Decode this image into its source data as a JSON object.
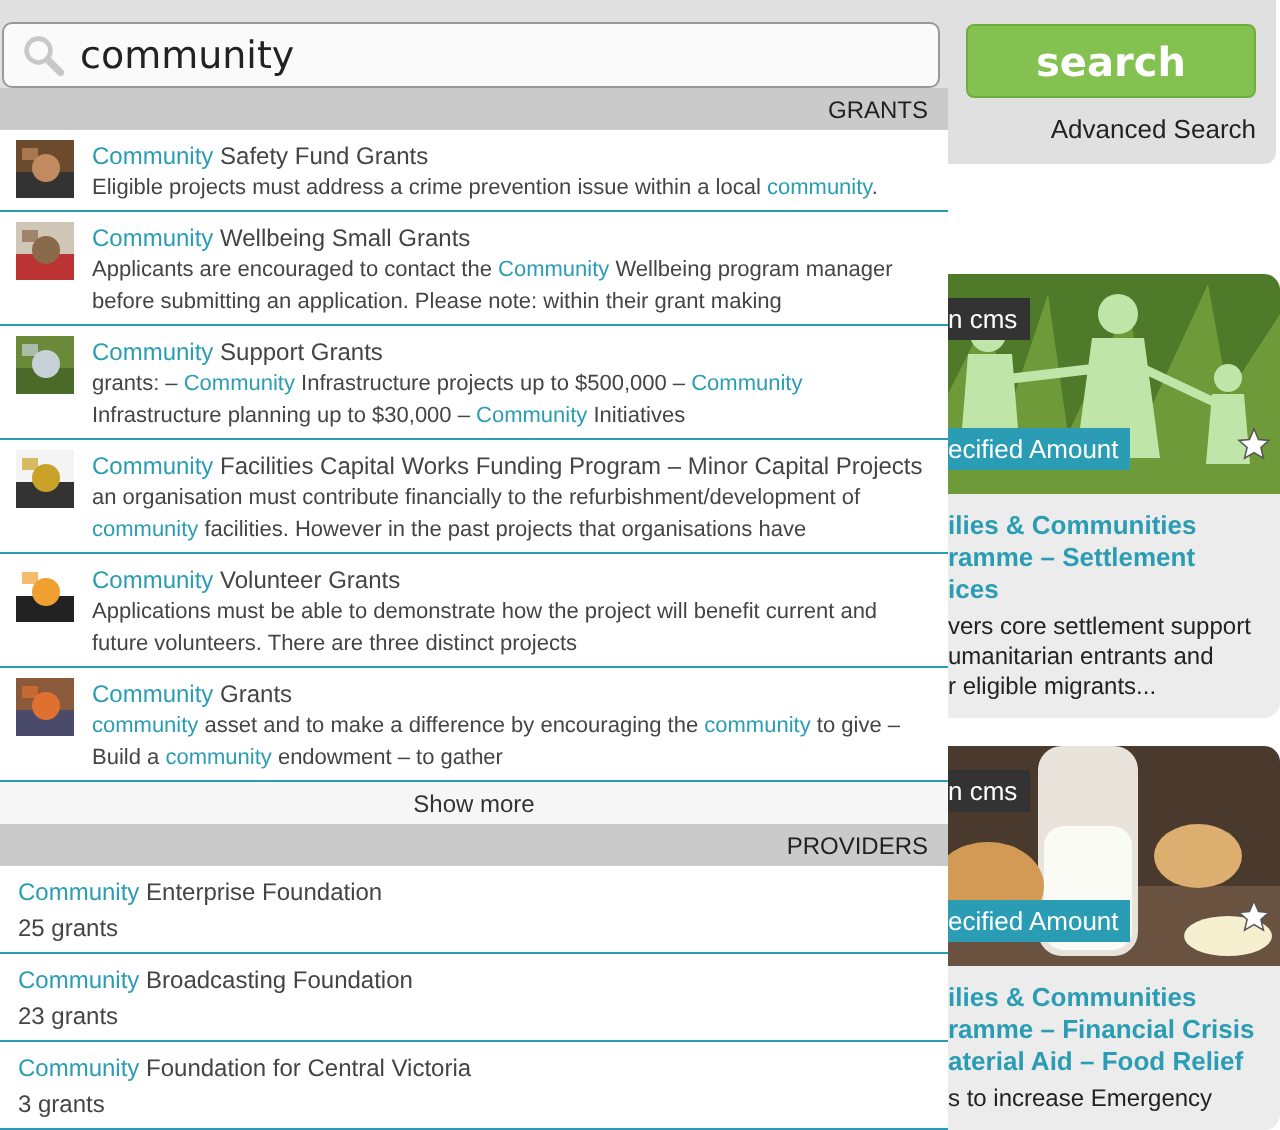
{
  "search": {
    "value": "community",
    "button": "search",
    "advanced_link": "Advanced Search"
  },
  "grants": {
    "header": "GRANTS",
    "show_more": "Show more",
    "items": [
      {
        "title": [
          {
            "text": "Community",
            "match": true
          },
          {
            "text": " Safety Fund Grants",
            "match": false
          }
        ],
        "lines": [
          [
            {
              "text": "Eligible projects must address a crime prevention issue within a local ",
              "match": false
            },
            {
              "text": "community",
              "match": true
            },
            {
              "text": ".",
              "match": false
            }
          ]
        ]
      },
      {
        "title": [
          {
            "text": "Community",
            "match": true
          },
          {
            "text": " Wellbeing Small Grants",
            "match": false
          }
        ],
        "lines": [
          [
            {
              "text": "Applicants are encouraged to contact the ",
              "match": false
            },
            {
              "text": "Community",
              "match": true
            },
            {
              "text": " Wellbeing program manager",
              "match": false
            }
          ],
          [
            {
              "text": "before submitting an application. Please note: within their grant making",
              "match": false
            }
          ]
        ]
      },
      {
        "title": [
          {
            "text": "Community",
            "match": true
          },
          {
            "text": " Support Grants",
            "match": false
          }
        ],
        "lines": [
          [
            {
              "text": "grants: – ",
              "match": false
            },
            {
              "text": "Community",
              "match": true
            },
            {
              "text": " Infrastructure projects up to $500,000 – ",
              "match": false
            },
            {
              "text": "Community",
              "match": true
            }
          ],
          [
            {
              "text": "Infrastructure planning up to $30,000 – ",
              "match": false
            },
            {
              "text": "Community",
              "match": true
            },
            {
              "text": " Initiatives",
              "match": false
            }
          ]
        ]
      },
      {
        "title": [
          {
            "text": "Community",
            "match": true
          },
          {
            "text": " Facilities Capital Works Funding Program – Minor Capital Projects",
            "match": false
          }
        ],
        "lines": [
          [
            {
              "text": "an organisation must contribute financially to the refurbishment/development of",
              "match": false
            }
          ],
          [
            {
              "text": "community",
              "match": true
            },
            {
              "text": " facilities. However in the past projects that organisations have",
              "match": false
            }
          ]
        ]
      },
      {
        "title": [
          {
            "text": "Community",
            "match": true
          },
          {
            "text": " Volunteer Grants",
            "match": false
          }
        ],
        "lines": [
          [
            {
              "text": "Applications must be able to demonstrate how the project will benefit current and",
              "match": false
            }
          ],
          [
            {
              "text": "future volunteers. There are three distinct projects",
              "match": false
            }
          ]
        ]
      },
      {
        "title": [
          {
            "text": "Community",
            "match": true
          },
          {
            "text": " Grants",
            "match": false
          }
        ],
        "lines": [
          [
            {
              "text": "community",
              "match": true
            },
            {
              "text": " asset and to make a difference by encouraging the ",
              "match": false
            },
            {
              "text": "community",
              "match": true
            },
            {
              "text": " to give –",
              "match": false
            }
          ],
          [
            {
              "text": "Build a ",
              "match": false
            },
            {
              "text": "community",
              "match": true
            },
            {
              "text": " endowment – to gather",
              "match": false
            }
          ]
        ]
      }
    ]
  },
  "providers": {
    "header": "PROVIDERS",
    "items": [
      {
        "name": [
          {
            "text": "Community",
            "match": true
          },
          {
            "text": " Enterprise Foundation",
            "match": false
          }
        ],
        "count": "25 grants"
      },
      {
        "name": [
          {
            "text": "Community",
            "match": true
          },
          {
            "text": " Broadcasting Foundation",
            "match": false
          }
        ],
        "count": "23 grants"
      },
      {
        "name": [
          {
            "text": "Community",
            "match": true
          },
          {
            "text": " Foundation for Central Victoria",
            "match": false
          }
        ],
        "count": "3 grants"
      }
    ]
  },
  "cards": [
    {
      "tag": "n cms",
      "amount": "ecified Amount",
      "starred": false,
      "title_lines": [
        "ilies & Communities",
        "ramme – Settlement",
        "ices"
      ],
      "desc_lines": [
        "vers core settlement support",
        "umanitarian entrants and",
        "r eligible migrants..."
      ]
    },
    {
      "tag": "n cms",
      "amount": "ecified Amount",
      "starred": false,
      "title_lines": [
        "ilies & Communities",
        "ramme – Financial Crisis",
        "aterial Aid – Food Relief"
      ],
      "desc_lines": [
        "s to increase Emergency"
      ]
    }
  ]
}
